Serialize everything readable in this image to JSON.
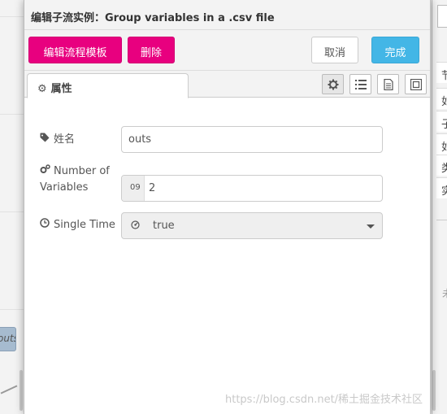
{
  "dialog": {
    "title": "编辑子流实例：Group variables in a .csv file",
    "toolbar": {
      "edit_template_label": "编辑流程模板",
      "delete_label": "删除",
      "cancel_label": "取消",
      "done_label": "完成"
    },
    "tabs": [
      {
        "label": "属性",
        "icon": "gear-icon"
      }
    ],
    "view_icons": [
      "gear-icon",
      "list-icon",
      "document-icon",
      "frame-icon"
    ],
    "form": {
      "name": {
        "label": "姓名",
        "icon": "tag-icon",
        "value": "outs"
      },
      "number_of_variables": {
        "label": "Number of Variables",
        "icon": "gears-icon",
        "type_badge": "09",
        "value": "2"
      },
      "single_time": {
        "label": "Single Time",
        "icon": "clock-icon",
        "value": "true",
        "type_icon": "boolean-icon"
      }
    }
  },
  "sidebar": {
    "rows": [
      "节",
      "如",
      "子",
      "如",
      "类",
      "实"
    ],
    "footer": "未"
  },
  "workspace": {
    "node_label": "outs"
  },
  "watermark": "https://blog.csdn.net/稀土掘金技术社区",
  "colors": {
    "primary_button": "#e8007f",
    "done_button": "#43b6e6"
  }
}
